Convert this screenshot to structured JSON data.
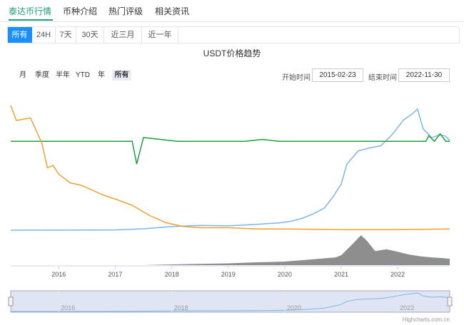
{
  "top_tabs": [
    {
      "label": "泰达币行情",
      "active": true
    },
    {
      "label": "币种介绍",
      "active": false
    },
    {
      "label": "热门评级",
      "active": false
    },
    {
      "label": "相关资讯",
      "active": false
    }
  ],
  "range_buttons": [
    {
      "label": "所有",
      "active": true
    },
    {
      "label": "24H",
      "active": false
    },
    {
      "label": "7天",
      "active": false
    },
    {
      "label": "30天",
      "active": false
    },
    {
      "label": "近三月",
      "active": false
    },
    {
      "label": "近一年",
      "active": false
    }
  ],
  "zoom_buttons": [
    {
      "label": "月",
      "active": false
    },
    {
      "label": "季度",
      "active": false
    },
    {
      "label": "半年",
      "active": false
    },
    {
      "label": "YTD",
      "active": false
    },
    {
      "label": "年",
      "active": false
    },
    {
      "label": "所有",
      "active": true
    }
  ],
  "date_range": {
    "start_label": "开始时间",
    "start_value": "2015-02-23",
    "end_label": "结束时间",
    "end_value": "2022-11-30"
  },
  "credits": "Highcharts.com.cn",
  "colors": {
    "accent": "#1e9c7d",
    "active_button": "#1890ff",
    "market_cap_line": "#7cb5ec",
    "price_line": "#1f9e3b",
    "volume_line": "#f0a030",
    "volume_area": "#7a7a7a",
    "navigator_fill": "#d6dcf0"
  },
  "chart_data": {
    "type": "line",
    "title": "USDT价格趋势",
    "x_range": [
      "2015-02-23",
      "2022-11-30"
    ],
    "x_ticks": [
      "2016",
      "2017",
      "2018",
      "2019",
      "2020",
      "2021",
      "2022"
    ],
    "navigator_ticks": [
      "2016",
      "2018",
      "2020",
      "2022"
    ],
    "grid": false,
    "series": [
      {
        "key": "market_cap",
        "x": [
          2015.15,
          2016.0,
          2017.0,
          2017.5,
          2018.0,
          2018.5,
          2019.0,
          2019.5,
          2019.9,
          2020.1,
          2020.3,
          2020.5,
          2020.7,
          2020.85,
          2021.0,
          2021.1,
          2021.3,
          2021.5,
          2021.7,
          2021.9,
          2022.0,
          2022.1,
          2022.25,
          2022.35,
          2022.45,
          2022.6,
          2022.75,
          2022.85,
          2022.92
        ],
        "y": [
          0.0,
          0.1,
          0.4,
          2.0,
          5.0,
          6.5,
          6.0,
          8.0,
          10.0,
          12.0,
          16.0,
          22.0,
          30.0,
          45.0,
          63.0,
          90.0,
          108.0,
          112.0,
          115.0,
          130.0,
          140.0,
          150.0,
          158.0,
          165.0,
          138.0,
          126.0,
          130.0,
          128.0,
          122.0
        ]
      },
      {
        "key": "price",
        "x": [
          2015.15,
          2015.2,
          2015.4,
          2015.6,
          2015.8,
          2016.0,
          2016.3,
          2016.6,
          2016.9,
          2017.2,
          2017.3,
          2017.38,
          2017.5,
          2017.8,
          2018.1,
          2018.5,
          2018.8,
          2019.0,
          2019.3,
          2019.6,
          2019.9,
          2020.2,
          2020.5,
          2020.8,
          2021.0,
          2021.3,
          2021.6,
          2021.9,
          2022.2,
          2022.35,
          2022.5,
          2022.55,
          2022.65,
          2022.75,
          2022.85,
          2022.92
        ],
        "y": [
          1.0,
          1.0,
          1.0,
          1.0,
          1.0,
          1.0,
          1.0,
          1.0,
          1.0,
          1.0,
          1.0,
          0.88,
          1.02,
          1.01,
          1.0,
          1.0,
          1.0,
          1.0,
          1.0,
          1.01,
          1.0,
          1.0,
          1.0,
          1.0,
          1.0,
          1.0,
          1.0,
          1.0,
          1.0,
          1.0,
          1.0,
          1.03,
          1.0,
          1.04,
          1.0,
          1.0
        ]
      },
      {
        "key": "volume_trend",
        "x": [
          2015.15,
          2015.25,
          2015.5,
          2015.7,
          2015.8,
          2015.9,
          2016.0,
          2016.2,
          2016.4,
          2016.6,
          2016.8,
          2017.0,
          2017.3,
          2017.6,
          2017.9,
          2018.2,
          2018.5,
          2019.0,
          2019.5,
          2020.0,
          2021.0,
          2022.0,
          2022.92
        ],
        "y": [
          100,
          88,
          90,
          70,
          50,
          52,
          45,
          38,
          36,
          32,
          28,
          25,
          20,
          12,
          6,
          3,
          2,
          2,
          1,
          1,
          0.5,
          0.5,
          1
        ]
      },
      {
        "key": "volume",
        "x": [
          2015.15,
          2017.5,
          2018.0,
          2019.0,
          2019.5,
          2020.0,
          2020.3,
          2020.6,
          2020.9,
          2021.0,
          2021.2,
          2021.35,
          2021.45,
          2021.6,
          2021.8,
          2022.0,
          2022.2,
          2022.4,
          2022.6,
          2022.8,
          2022.92
        ],
        "y": [
          0,
          0,
          2,
          5,
          8,
          10,
          14,
          18,
          22,
          28,
          60,
          85,
          70,
          40,
          45,
          38,
          30,
          25,
          22,
          20,
          18
        ]
      }
    ]
  }
}
